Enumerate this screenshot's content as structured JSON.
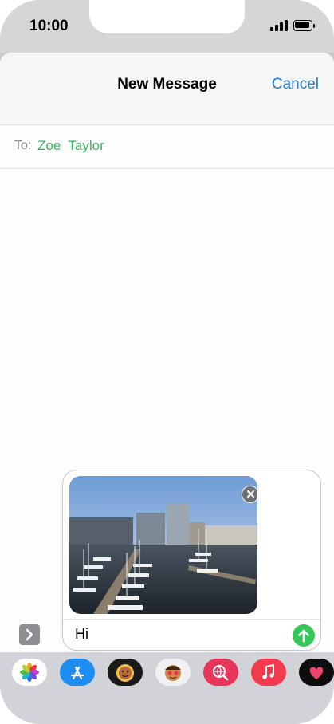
{
  "status_bar": {
    "time": "10:00"
  },
  "header": {
    "title": "New Message",
    "cancel_label": "Cancel"
  },
  "to_field": {
    "label": "To:",
    "recipient": "Zoe  Taylor"
  },
  "compose": {
    "message_text": "Hi",
    "attachment": "photo of a harbor marina with boats and buildings"
  },
  "app_drawer": {
    "items": [
      {
        "icon": "photos-icon"
      },
      {
        "icon": "app-store-icon"
      },
      {
        "icon": "memoji-stickers-icon"
      },
      {
        "icon": "animoji-icon"
      },
      {
        "icon": "image-search-icon"
      },
      {
        "icon": "music-icon"
      },
      {
        "icon": "digital-touch-icon"
      }
    ]
  },
  "colors": {
    "accent_blue": "#1f7fd9",
    "recipient_green": "#31b95c",
    "send_green": "#34c759"
  }
}
